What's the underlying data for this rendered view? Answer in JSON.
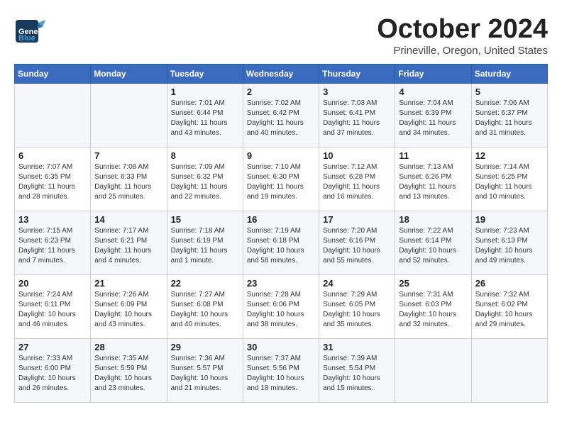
{
  "header": {
    "logo_line1": "General",
    "logo_line2": "Blue",
    "month": "October 2024",
    "location": "Prineville, Oregon, United States"
  },
  "days_of_week": [
    "Sunday",
    "Monday",
    "Tuesday",
    "Wednesday",
    "Thursday",
    "Friday",
    "Saturday"
  ],
  "weeks": [
    [
      {
        "day": "",
        "info": ""
      },
      {
        "day": "",
        "info": ""
      },
      {
        "day": "1",
        "info": "Sunrise: 7:01 AM\nSunset: 6:44 PM\nDaylight: 11 hours and 43 minutes."
      },
      {
        "day": "2",
        "info": "Sunrise: 7:02 AM\nSunset: 6:42 PM\nDaylight: 11 hours and 40 minutes."
      },
      {
        "day": "3",
        "info": "Sunrise: 7:03 AM\nSunset: 6:41 PM\nDaylight: 11 hours and 37 minutes."
      },
      {
        "day": "4",
        "info": "Sunrise: 7:04 AM\nSunset: 6:39 PM\nDaylight: 11 hours and 34 minutes."
      },
      {
        "day": "5",
        "info": "Sunrise: 7:06 AM\nSunset: 6:37 PM\nDaylight: 11 hours and 31 minutes."
      }
    ],
    [
      {
        "day": "6",
        "info": "Sunrise: 7:07 AM\nSunset: 6:35 PM\nDaylight: 11 hours and 28 minutes."
      },
      {
        "day": "7",
        "info": "Sunrise: 7:08 AM\nSunset: 6:33 PM\nDaylight: 11 hours and 25 minutes."
      },
      {
        "day": "8",
        "info": "Sunrise: 7:09 AM\nSunset: 6:32 PM\nDaylight: 11 hours and 22 minutes."
      },
      {
        "day": "9",
        "info": "Sunrise: 7:10 AM\nSunset: 6:30 PM\nDaylight: 11 hours and 19 minutes."
      },
      {
        "day": "10",
        "info": "Sunrise: 7:12 AM\nSunset: 6:28 PM\nDaylight: 11 hours and 16 minutes."
      },
      {
        "day": "11",
        "info": "Sunrise: 7:13 AM\nSunset: 6:26 PM\nDaylight: 11 hours and 13 minutes."
      },
      {
        "day": "12",
        "info": "Sunrise: 7:14 AM\nSunset: 6:25 PM\nDaylight: 11 hours and 10 minutes."
      }
    ],
    [
      {
        "day": "13",
        "info": "Sunrise: 7:15 AM\nSunset: 6:23 PM\nDaylight: 11 hours and 7 minutes."
      },
      {
        "day": "14",
        "info": "Sunrise: 7:17 AM\nSunset: 6:21 PM\nDaylight: 11 hours and 4 minutes."
      },
      {
        "day": "15",
        "info": "Sunrise: 7:18 AM\nSunset: 6:19 PM\nDaylight: 11 hours and 1 minute."
      },
      {
        "day": "16",
        "info": "Sunrise: 7:19 AM\nSunset: 6:18 PM\nDaylight: 10 hours and 58 minutes."
      },
      {
        "day": "17",
        "info": "Sunrise: 7:20 AM\nSunset: 6:16 PM\nDaylight: 10 hours and 55 minutes."
      },
      {
        "day": "18",
        "info": "Sunrise: 7:22 AM\nSunset: 6:14 PM\nDaylight: 10 hours and 52 minutes."
      },
      {
        "day": "19",
        "info": "Sunrise: 7:23 AM\nSunset: 6:13 PM\nDaylight: 10 hours and 49 minutes."
      }
    ],
    [
      {
        "day": "20",
        "info": "Sunrise: 7:24 AM\nSunset: 6:11 PM\nDaylight: 10 hours and 46 minutes."
      },
      {
        "day": "21",
        "info": "Sunrise: 7:26 AM\nSunset: 6:09 PM\nDaylight: 10 hours and 43 minutes."
      },
      {
        "day": "22",
        "info": "Sunrise: 7:27 AM\nSunset: 6:08 PM\nDaylight: 10 hours and 40 minutes."
      },
      {
        "day": "23",
        "info": "Sunrise: 7:28 AM\nSunset: 6:06 PM\nDaylight: 10 hours and 38 minutes."
      },
      {
        "day": "24",
        "info": "Sunrise: 7:29 AM\nSunset: 6:05 PM\nDaylight: 10 hours and 35 minutes."
      },
      {
        "day": "25",
        "info": "Sunrise: 7:31 AM\nSunset: 6:03 PM\nDaylight: 10 hours and 32 minutes."
      },
      {
        "day": "26",
        "info": "Sunrise: 7:32 AM\nSunset: 6:02 PM\nDaylight: 10 hours and 29 minutes."
      }
    ],
    [
      {
        "day": "27",
        "info": "Sunrise: 7:33 AM\nSunset: 6:00 PM\nDaylight: 10 hours and 26 minutes."
      },
      {
        "day": "28",
        "info": "Sunrise: 7:35 AM\nSunset: 5:59 PM\nDaylight: 10 hours and 23 minutes."
      },
      {
        "day": "29",
        "info": "Sunrise: 7:36 AM\nSunset: 5:57 PM\nDaylight: 10 hours and 21 minutes."
      },
      {
        "day": "30",
        "info": "Sunrise: 7:37 AM\nSunset: 5:56 PM\nDaylight: 10 hours and 18 minutes."
      },
      {
        "day": "31",
        "info": "Sunrise: 7:39 AM\nSunset: 5:54 PM\nDaylight: 10 hours and 15 minutes."
      },
      {
        "day": "",
        "info": ""
      },
      {
        "day": "",
        "info": ""
      }
    ]
  ]
}
